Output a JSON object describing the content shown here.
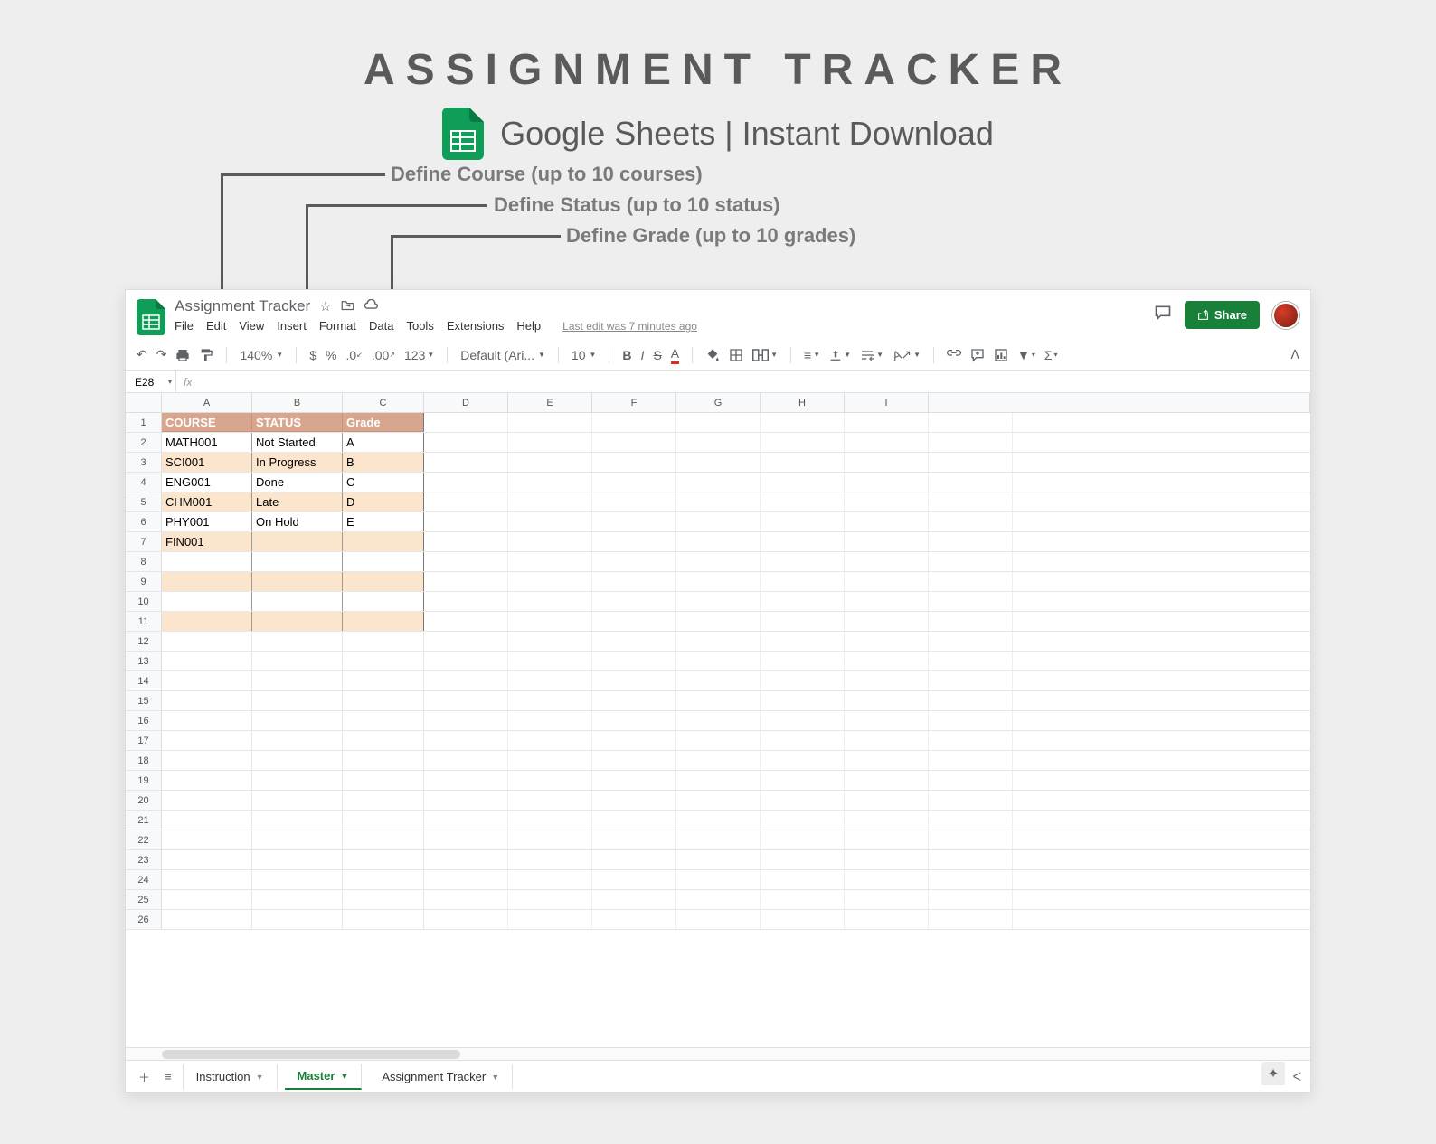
{
  "promo": {
    "title": "ASSIGNMENT TRACKER",
    "subtitle": "Google Sheets | Instant Download",
    "callouts": {
      "course": "Define Course  (up to 10 courses)",
      "status": "Define Status  (up to 10 status)",
      "grade": "Define Grade (up to 10 grades)"
    }
  },
  "doc": {
    "title": "Assignment Tracker",
    "last_edit": "Last edit was 7 minutes ago",
    "menus": [
      "File",
      "Edit",
      "View",
      "Insert",
      "Format",
      "Data",
      "Tools",
      "Extensions",
      "Help"
    ],
    "share": "Share"
  },
  "toolbar": {
    "zoom": "140%",
    "currency": "$",
    "percent": "%",
    "dec_dec": ".0",
    "dec_inc": ".00",
    "num_format": "123",
    "font_name": "Default (Ari...",
    "font_size": "10"
  },
  "namebox": {
    "ref": "E28"
  },
  "grid": {
    "cols": [
      "A",
      "B",
      "C",
      "D",
      "E",
      "F",
      "G",
      "H",
      "I"
    ],
    "headers": {
      "a": "COURSE",
      "b": "STATUS",
      "c": "Grade"
    },
    "rows": [
      {
        "n": 1,
        "hdr": true
      },
      {
        "n": 2,
        "a": "MATH001",
        "b": "Not Started",
        "c": "A",
        "tint": false
      },
      {
        "n": 3,
        "a": "SCI001",
        "b": "In Progress",
        "c": "B",
        "tint": true
      },
      {
        "n": 4,
        "a": "ENG001",
        "b": "Done",
        "c": "C",
        "tint": false
      },
      {
        "n": 5,
        "a": "CHM001",
        "b": "Late",
        "c": "D",
        "tint": true
      },
      {
        "n": 6,
        "a": "PHY001",
        "b": "On Hold",
        "c": "E",
        "tint": false
      },
      {
        "n": 7,
        "a": "FIN001",
        "b": "",
        "c": "",
        "tint": true
      },
      {
        "n": 8,
        "a": "",
        "b": "",
        "c": "",
        "tint": false
      },
      {
        "n": 9,
        "a": "",
        "b": "",
        "c": "",
        "tint": true
      },
      {
        "n": 10,
        "a": "",
        "b": "",
        "c": "",
        "tint": false
      },
      {
        "n": 11,
        "a": "",
        "b": "",
        "c": "",
        "tint": true
      },
      {
        "n": 12
      },
      {
        "n": 13
      },
      {
        "n": 14
      },
      {
        "n": 15
      },
      {
        "n": 16
      },
      {
        "n": 17
      },
      {
        "n": 18
      },
      {
        "n": 19
      },
      {
        "n": 20
      },
      {
        "n": 21
      },
      {
        "n": 22
      },
      {
        "n": 23
      },
      {
        "n": 24
      },
      {
        "n": 25
      },
      {
        "n": 26
      }
    ]
  },
  "tabs": {
    "items": [
      {
        "label": "Instruction",
        "active": false
      },
      {
        "label": "Master",
        "active": true
      },
      {
        "label": "Assignment Tracker",
        "active": false
      }
    ]
  }
}
